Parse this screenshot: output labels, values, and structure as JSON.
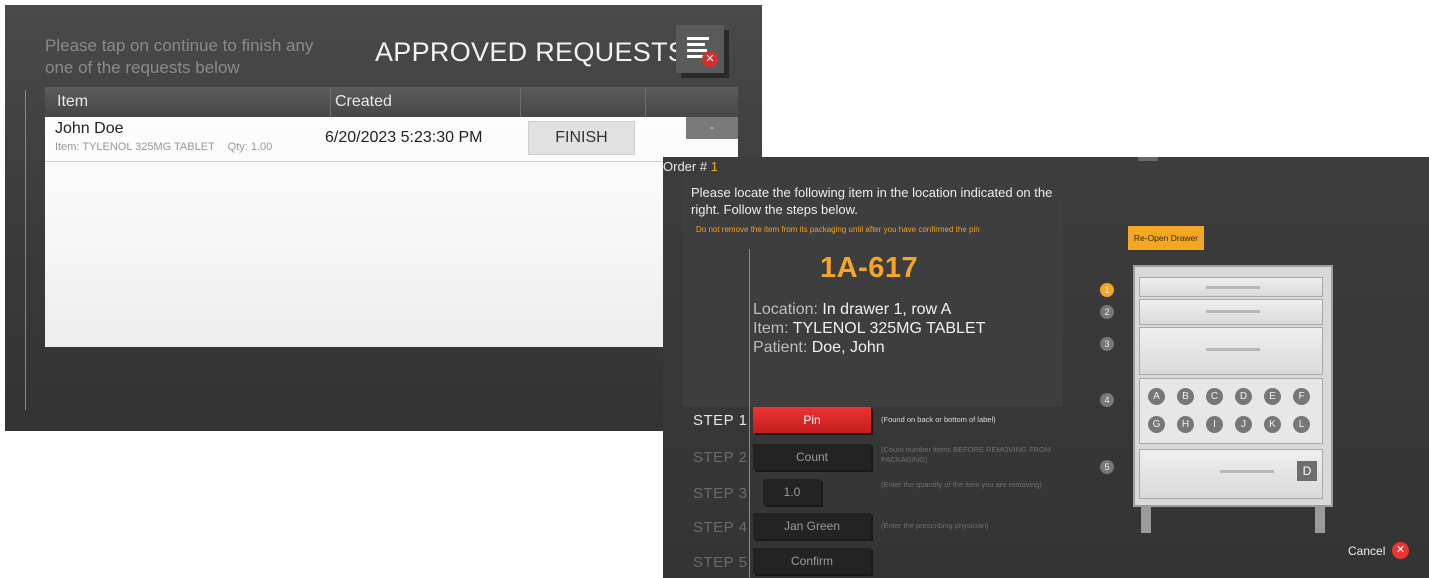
{
  "approved": {
    "instruction": "Please tap on continue to finish any one of the requests below",
    "title": "APPROVED REQUESTS",
    "columns": [
      "Item",
      "Created"
    ],
    "rows": [
      {
        "name": "John Doe",
        "item_label": "Item:",
        "item": "TYLENOL 325MG TABLET",
        "qty_label": "Qty:",
        "qty": "1.00",
        "created": "6/20/2023 5:23:30 PM",
        "action": "FINISH",
        "extra": "-"
      }
    ]
  },
  "locate": {
    "order_label": "Order #",
    "order_number": "1",
    "instruction": "Please locate the following item in the location indicated on the right. Follow the steps below.",
    "warning": "Do not remove the item from its packaging until after you have confirmed the pin",
    "code": "1A-617",
    "location_label": "Location:",
    "location": "In drawer 1, row A",
    "item_label": "Item:",
    "item": "TYLENOL 325MG TABLET",
    "patient_label": "Patient:",
    "patient": "Doe, John",
    "steps": [
      {
        "label": "STEP 1",
        "button": "Pin",
        "note": "(Found on back or bottom of label)"
      },
      {
        "label": "STEP 2",
        "button": "Count",
        "note": "(Count number items BEFORE REMOVING FROM PACKAGING)"
      },
      {
        "label": "STEP 3",
        "button": "1.0",
        "note": "(Enter the quantity of the item you are removing)"
      },
      {
        "label": "STEP 4",
        "button": "Jan Green",
        "note": "(Enter the prescribing physician)"
      },
      {
        "label": "STEP 5",
        "button": "Confirm",
        "note": ""
      }
    ],
    "reopen": "Re-Open Drawer",
    "drawer_numbers": [
      "1",
      "2",
      "3",
      "4",
      "5"
    ],
    "slot_row1": [
      "A",
      "B",
      "C",
      "D",
      "E",
      "F"
    ],
    "slot_row2": [
      "G",
      "H",
      "I",
      "J",
      "K",
      "L"
    ],
    "drawer_badge": "D",
    "cancel": "Cancel"
  },
  "colors": {
    "accent": "#f5a623",
    "danger": "#e33333"
  }
}
